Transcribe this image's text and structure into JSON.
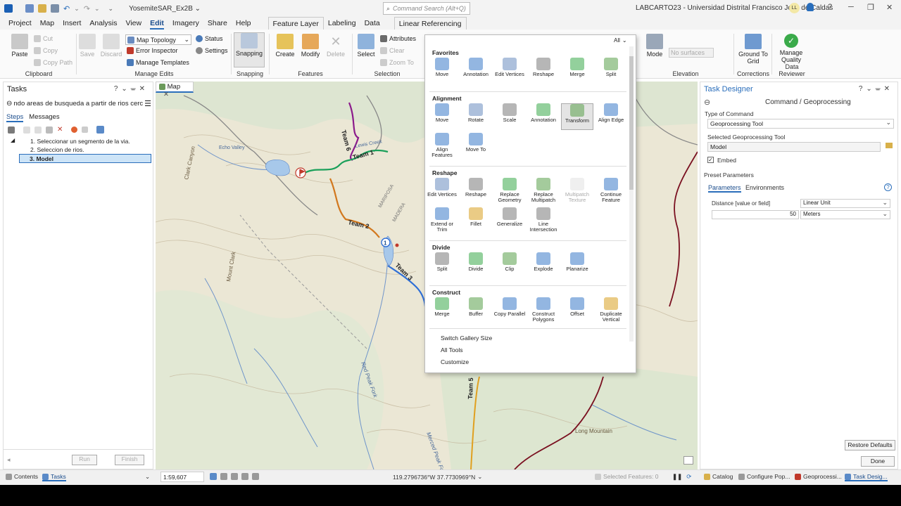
{
  "titlebar": {
    "project": "YosemiteSAR_Ex2B ⌄",
    "search_placeholder": "Command Search (Alt+Q)",
    "org": "LABCARTO23 - Universidad Distrital Francisco Jose de Caldas",
    "avatar": "LL",
    "minimize": "─",
    "maximize": "❐",
    "close": "✕",
    "help": "?"
  },
  "menu": {
    "tabs": [
      "Project",
      "Map",
      "Insert",
      "Analysis",
      "View",
      "Edit",
      "Imagery",
      "Share",
      "Help"
    ],
    "active": "Edit",
    "context_tabs": [
      "Feature Layer",
      "Labeling",
      "Data"
    ],
    "linear": "Linear Referencing"
  },
  "ribbon": {
    "clipboard": {
      "label": "Clipboard",
      "paste": "Paste",
      "cut": "Cut",
      "copy": "Copy",
      "copy_path": "Copy Path"
    },
    "manage_edits": {
      "label": "Manage Edits",
      "save": "Save",
      "discard": "Discard",
      "map_topology": "Map Topology",
      "error_inspector": "Error Inspector",
      "manage_templates": "Manage Templates",
      "status": "Status",
      "settings": "Settings"
    },
    "snapping": {
      "label": "Snapping",
      "btn": "Snapping"
    },
    "features": {
      "label": "Features",
      "create": "Create",
      "modify": "Modify",
      "delete": "Delete"
    },
    "selection": {
      "label": "Selection",
      "select": "Select",
      "attributes": "Attributes",
      "clear": "Clear",
      "zoom_to": "Zoom To"
    },
    "elevation": {
      "label": "Elevation",
      "mode": "Mode",
      "surfaces": "No surfaces"
    },
    "corrections": {
      "label": "Corrections",
      "ground": "Ground To Grid"
    },
    "data_reviewer": {
      "label": "Data Reviewer",
      "manage_quality": "Manage Quality"
    }
  },
  "tasks": {
    "title": "Tasks",
    "task_name": "ndo areas de busqueda a partir de rios cerca",
    "tab_steps": "Steps",
    "tab_messages": "Messages",
    "steps": [
      {
        "n": "1.",
        "label": "Seleccionar un segmento de la via."
      },
      {
        "n": "2.",
        "label": "Seleccion de rios."
      },
      {
        "n": "3.",
        "label": "Model"
      }
    ],
    "run": "Run",
    "finish": "Finish"
  },
  "map": {
    "tab": "Map",
    "teams": [
      "Team 1",
      "Team 2",
      "Team 3",
      "Team 5",
      "Team 6"
    ],
    "places": [
      "Mount Clark",
      "Red Peak Fork",
      "Merced Peak Fork",
      "Long Mountain",
      "Clark Canyon",
      "Echo Valley",
      "Lewis Creek",
      "MARIPOSA",
      "MADERA"
    ],
    "marker": "1"
  },
  "gallery": {
    "filter": "All",
    "sections": [
      {
        "title": "Favorites",
        "items": [
          "Move",
          "Annotation",
          "Edit Vertices",
          "Reshape",
          "Merge",
          "Split"
        ]
      },
      {
        "title": "Alignment",
        "items": [
          "Move",
          "Rotate",
          "Scale",
          "Annotation",
          "Transform",
          "Align Edge",
          "Align Features",
          "Move To"
        ]
      },
      {
        "title": "Reshape",
        "items": [
          "Edit Vertices",
          "Reshape",
          "Replace Geometry",
          "Replace Multipatch",
          "Multipatch Texture",
          "Continue Feature",
          "Extend or Trim",
          "Fillet",
          "Generalize",
          "Line Intersection"
        ]
      },
      {
        "title": "Divide",
        "items": [
          "Split",
          "Divide",
          "Clip",
          "Explode",
          "Planarize"
        ]
      },
      {
        "title": "Construct",
        "items": [
          "Merge",
          "Buffer",
          "Copy Parallel",
          "Construct Polygons",
          "Offset",
          "Duplicate Vertical"
        ]
      }
    ],
    "links": [
      "Switch Gallery Size",
      "All Tools",
      "Customize"
    ]
  },
  "task_designer": {
    "title": "Task Designer",
    "heading": "Command / Geoprocessing",
    "type_label": "Type of Command",
    "type_value": "Geoprocessing Tool",
    "tool_label": "Selected Geoprocessing Tool",
    "tool_value": "Model",
    "embed": "Embed",
    "preset": "Preset Parameters",
    "tab_params": "Parameters",
    "tab_env": "Environments",
    "param_label": "Distance [value or field]",
    "param_type": "Linear Unit",
    "param_value": "50",
    "param_unit": "Meters",
    "restore": "Restore Defaults",
    "done": "Done"
  },
  "statusbar": {
    "contents": "Contents",
    "tasks": "Tasks",
    "scale": "1:59,607",
    "coords": "119.2796736°W 37.7730969°N",
    "selected": "Selected Features: 0",
    "catalog": "Catalog",
    "configure": "Configure Pop...",
    "geoprocessing": "Geoprocessi...",
    "task_design": "Task Desig..."
  },
  "colors": {
    "accent": "#2a6ebb",
    "team1": "#1aa05a",
    "team2": "#d2781e",
    "team3": "#2f6fd6",
    "team5": "#e0a020",
    "team6": "#8b1a8b",
    "boundary": "#7a1020"
  }
}
